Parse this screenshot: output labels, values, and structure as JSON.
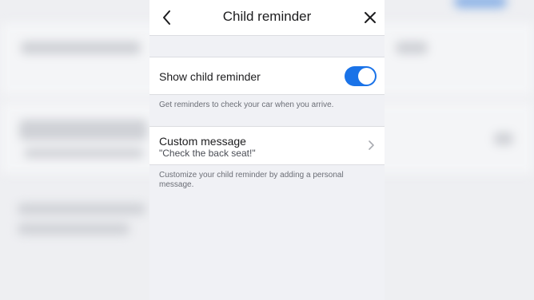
{
  "screen": {
    "title": "Child reminder",
    "back_icon": "chevron-left-icon",
    "close_icon": "close-icon"
  },
  "reminder": {
    "label": "Show child reminder",
    "enabled": true,
    "help": "Get reminders to check your car when you arrive."
  },
  "message": {
    "title": "Custom message",
    "value": "\"Check the back seat!\"",
    "chevron_icon": "chevron-right-icon",
    "help": "Customize your child reminder by adding a personal message."
  },
  "colors": {
    "accent": "#1a73e8",
    "background": "#f0f1f5"
  }
}
